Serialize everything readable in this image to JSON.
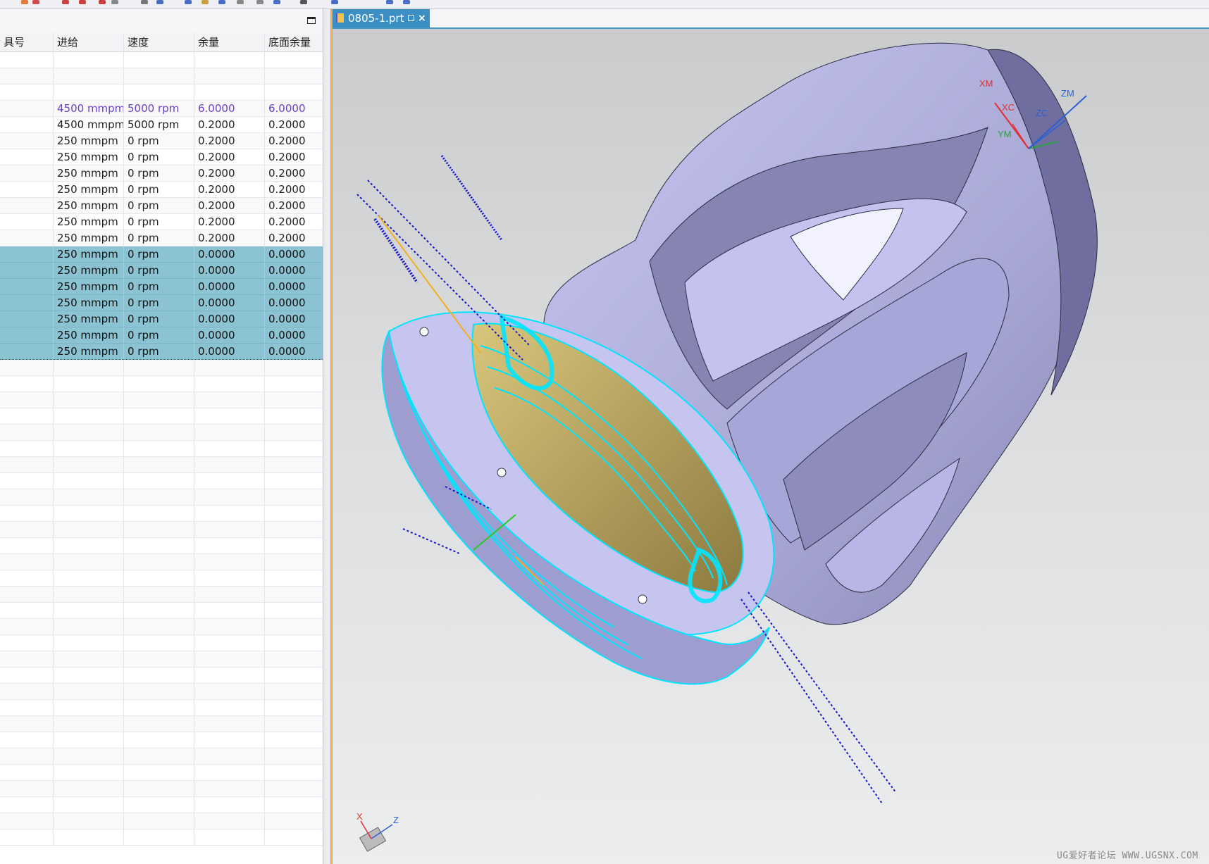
{
  "tab": {
    "title": "0805-1.prt",
    "close_glyph": "×"
  },
  "table": {
    "headers": [
      "具号",
      "进给",
      "速度",
      "余量",
      "底面余量"
    ],
    "rows": [
      [
        "",
        "",
        "",
        "",
        ""
      ],
      [
        "",
        "",
        "",
        "",
        ""
      ],
      [
        "",
        "",
        "",
        "",
        ""
      ],
      [
        "",
        "4500 mmpm",
        "5000 rpm",
        "6.0000",
        "6.0000"
      ],
      [
        "",
        "4500 mmpm",
        "5000 rpm",
        "0.2000",
        "0.2000"
      ],
      [
        "",
        "250 mmpm",
        "0 rpm",
        "0.2000",
        "0.2000"
      ],
      [
        "",
        "250 mmpm",
        "0 rpm",
        "0.2000",
        "0.2000"
      ],
      [
        "",
        "250 mmpm",
        "0 rpm",
        "0.2000",
        "0.2000"
      ],
      [
        "",
        "250 mmpm",
        "0 rpm",
        "0.2000",
        "0.2000"
      ],
      [
        "",
        "250 mmpm",
        "0 rpm",
        "0.2000",
        "0.2000"
      ],
      [
        "",
        "250 mmpm",
        "0 rpm",
        "0.2000",
        "0.2000"
      ],
      [
        "",
        "250 mmpm",
        "0 rpm",
        "0.2000",
        "0.2000"
      ],
      [
        "",
        "250 mmpm",
        "0 rpm",
        "0.0000",
        "0.0000"
      ],
      [
        "",
        "250 mmpm",
        "0 rpm",
        "0.0000",
        "0.0000"
      ],
      [
        "",
        "250 mmpm",
        "0 rpm",
        "0.0000",
        "0.0000"
      ],
      [
        "",
        "250 mmpm",
        "0 rpm",
        "0.0000",
        "0.0000"
      ],
      [
        "",
        "250 mmpm",
        "0 rpm",
        "0.0000",
        "0.0000"
      ],
      [
        "",
        "250 mmpm",
        "0 rpm",
        "0.0000",
        "0.0000"
      ],
      [
        "",
        "250 mmpm",
        "0 rpm",
        "0.0000",
        "0.0000"
      ]
    ],
    "highlighted_row_index": 3,
    "selected_row_indices": [
      12,
      13,
      14,
      15,
      16,
      17,
      18
    ],
    "empty_row_count": 30
  },
  "triad": {
    "xm": "XM",
    "xc": "XC",
    "zm": "ZM",
    "zc": "ZC",
    "ym": "YM"
  },
  "view_triad": {
    "x": "X",
    "z": "Z"
  },
  "watermark": "UG爱好者论坛 WWW.UGSNX.COM",
  "colors": {
    "selection": "#8cc3d3",
    "tab": "#3b8fc2",
    "toolpath": "#00e5ff",
    "part": "#b9b8e8",
    "highlight_text": "#6a3fc2"
  }
}
